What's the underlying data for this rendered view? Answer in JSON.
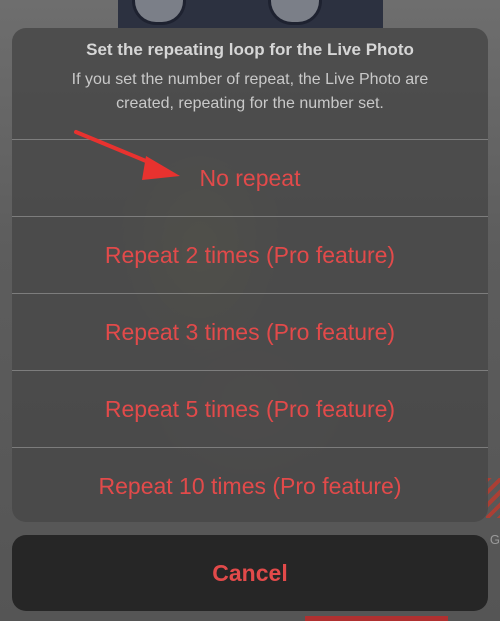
{
  "action_sheet": {
    "title": "Set the repeating loop for the Live Photo",
    "message": "If you set the number of repeat, the Live Photo are created, repeating for the number set.",
    "options": [
      {
        "label": "No repeat"
      },
      {
        "label": "Repeat 2 times (Pro feature)"
      },
      {
        "label": "Repeat 3 times (Pro feature)"
      },
      {
        "label": "Repeat 5 times (Pro feature)"
      },
      {
        "label": "Repeat 10 times (Pro feature)"
      }
    ],
    "cancel_label": "Cancel"
  },
  "background": {
    "partial_text": "G"
  },
  "colors": {
    "accent_red": "#e24a4a",
    "annotation_arrow": "#e8322f"
  }
}
